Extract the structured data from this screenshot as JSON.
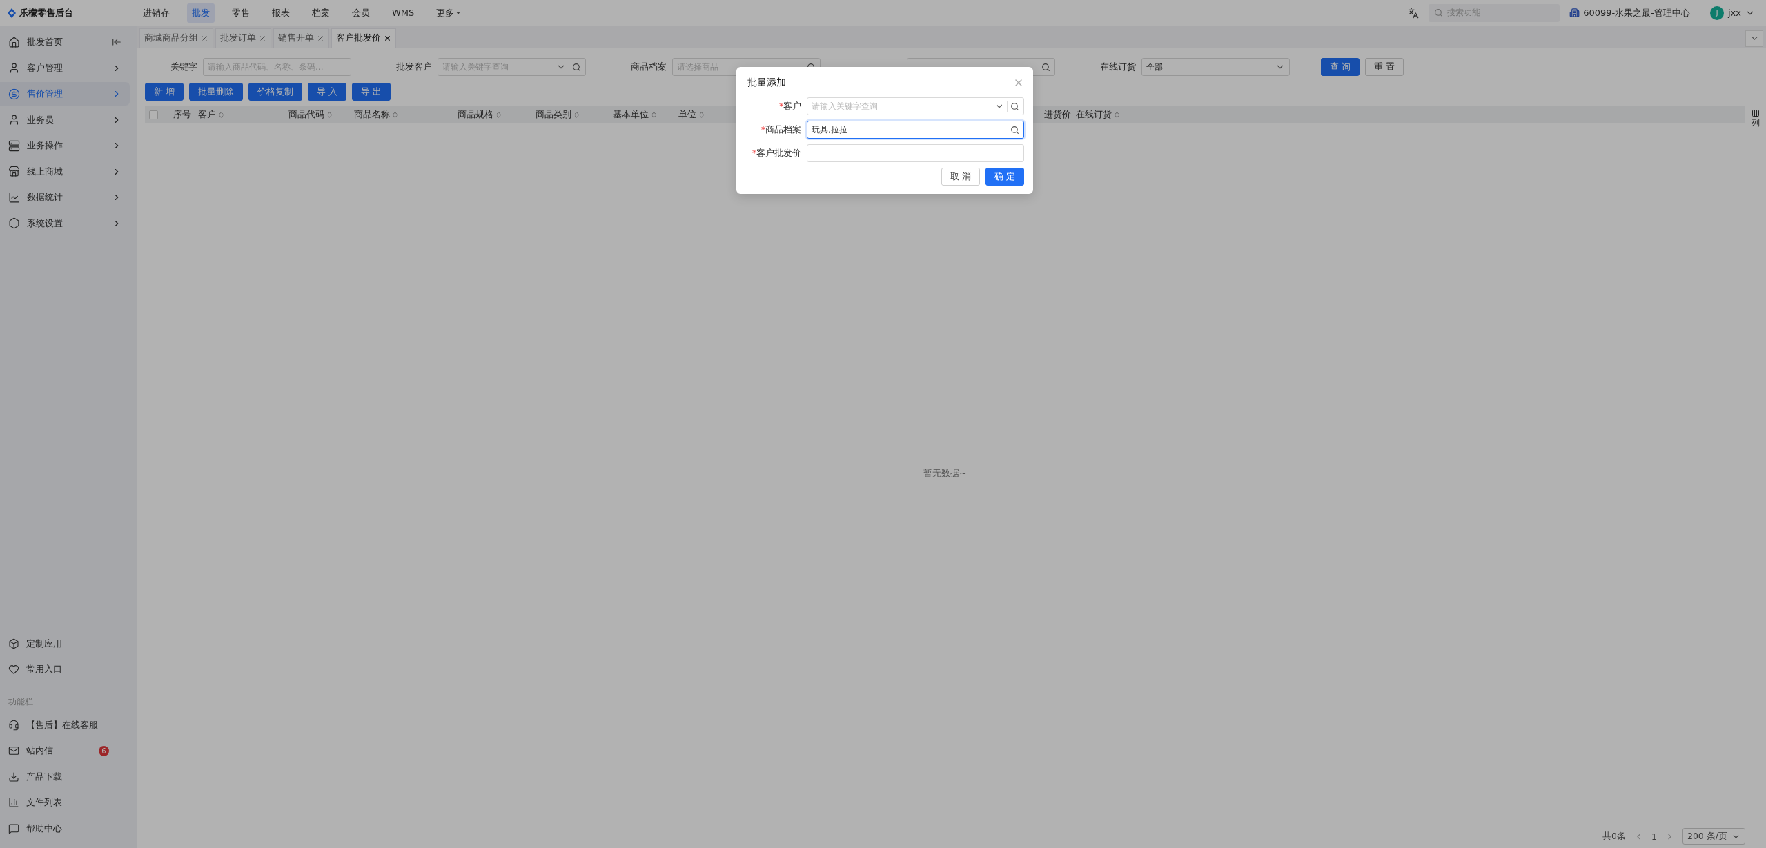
{
  "app": {
    "logo_text": "乐檬零售后台"
  },
  "top_nav": [
    {
      "label": "进销存",
      "selected": false,
      "has_menu": false
    },
    {
      "label": "批发",
      "selected": true,
      "has_menu": false
    },
    {
      "label": "零售",
      "selected": false,
      "has_menu": false
    },
    {
      "label": "报表",
      "selected": false,
      "has_menu": false
    },
    {
      "label": "档案",
      "selected": false,
      "has_menu": false
    },
    {
      "label": "会员",
      "selected": false,
      "has_menu": false
    },
    {
      "label": "WMS",
      "selected": false,
      "has_menu": false
    },
    {
      "label": "更多",
      "selected": false,
      "has_menu": true
    }
  ],
  "header_right": {
    "search": {
      "placeholder": "搜索功能"
    },
    "org": "60099-水果之最-管理中心",
    "avatar": "J",
    "user": "jxx"
  },
  "sidebar": {
    "items": [
      {
        "label": "批发首页",
        "selected": false,
        "kind": "collapse"
      },
      {
        "label": "客户管理",
        "selected": false,
        "kind": "submenu"
      },
      {
        "label": "售价管理",
        "selected": true,
        "kind": "submenu"
      },
      {
        "label": "业务员",
        "selected": false,
        "kind": "submenu"
      },
      {
        "label": "业务操作",
        "selected": false,
        "kind": "submenu"
      },
      {
        "label": "线上商城",
        "selected": false,
        "kind": "submenu"
      },
      {
        "label": "数据统计",
        "selected": false,
        "kind": "submenu"
      },
      {
        "label": "系统设置",
        "selected": false,
        "kind": "submenu"
      }
    ],
    "shortcuts": [
      {
        "label": "定制应用"
      },
      {
        "label": "常用入口"
      }
    ],
    "section_title": "功能栏",
    "tools": [
      {
        "label": "【售后】在线客服"
      },
      {
        "label": "站内信",
        "badge": "6"
      },
      {
        "label": "产品下载"
      },
      {
        "label": "文件列表"
      },
      {
        "label": "帮助中心"
      }
    ]
  },
  "tabs": [
    {
      "label": "商城商品分组",
      "selected": false
    },
    {
      "label": "批发订单",
      "selected": false
    },
    {
      "label": "销售开单",
      "selected": false
    },
    {
      "label": "客户批发价",
      "selected": true
    }
  ],
  "filters": [
    {
      "label": "关键字",
      "kind": "text",
      "placeholder": "请输入商品代码、名称、条码..."
    },
    {
      "label": "批发客户",
      "kind": "select-search",
      "placeholder": "请输入关键字查询"
    },
    {
      "label": "商品档案",
      "kind": "search",
      "placeholder": "请选择商品"
    },
    {
      "kind": "search"
    },
    {
      "label": "在线订货",
      "kind": "select",
      "value": "全部"
    }
  ],
  "query_buttons": [
    {
      "label": "查 询",
      "kind": "primary"
    },
    {
      "label": "重 置",
      "kind": "default"
    }
  ],
  "actions": [
    "新 增",
    "批量删除",
    "价格复制",
    "导 入",
    "导 出"
  ],
  "table": {
    "select_all_checked": false,
    "columns": [
      {
        "label": "序号",
        "sortable": false
      },
      {
        "label": "客户",
        "sortable": true
      },
      {
        "label": "商品代码",
        "sortable": true
      },
      {
        "label": "商品名称",
        "sortable": true
      },
      {
        "label": "商品规格",
        "sortable": true
      },
      {
        "label": "商品类别",
        "sortable": true
      },
      {
        "label": "基本单位",
        "sortable": true
      },
      {
        "label": "单位",
        "sortable": true
      },
      {
        "label": "进货价",
        "sortable": false
      },
      {
        "label": "在线订货",
        "sortable": true
      }
    ],
    "empty_text": "暂无数据~",
    "column_setting": "列"
  },
  "pagination": {
    "total": "共0条",
    "page": "1",
    "page_size": "200 条/页"
  },
  "dialog": {
    "title": "批量添加",
    "fields": [
      {
        "label": "客户",
        "required_mark": "*",
        "kind": "select-search",
        "placeholder": "请输入关键字查询",
        "focused": false
      },
      {
        "label": "商品档案",
        "required_mark": "*",
        "kind": "search",
        "value": "玩具,拉拉",
        "focused": true
      },
      {
        "label": "客户批发价",
        "required_mark": "*",
        "kind": "text",
        "focused": false
      }
    ],
    "buttons": [
      {
        "label": "取 消",
        "kind": "default"
      },
      {
        "label": "确 定",
        "kind": "primary"
      }
    ]
  }
}
